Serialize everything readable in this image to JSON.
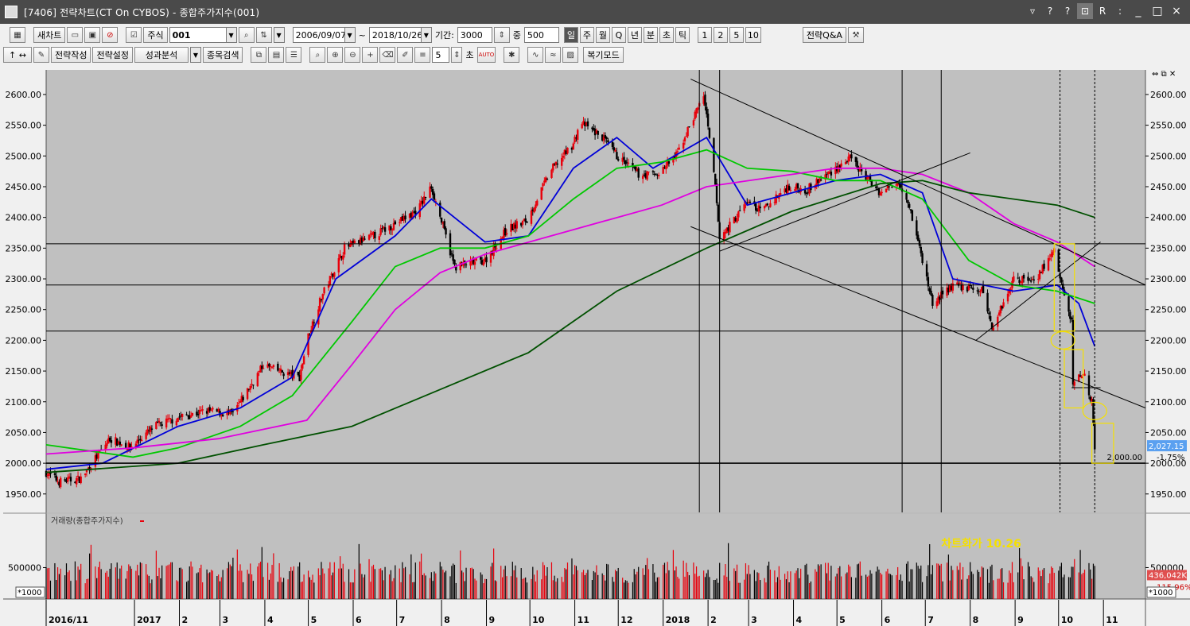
{
  "window": {
    "title": "[7406] 전략차트(CT On CYBOS) - 종합주가지수(001)",
    "buttons": [
      "?",
      "?",
      "R",
      "_",
      "□",
      "×"
    ]
  },
  "toolbar1": {
    "new_chart": "새차트",
    "stock_type": "주식",
    "code": "001",
    "start_date": "2006/09/07",
    "tilde": "~",
    "end_date": "2018/10/26",
    "period_label": "기간:",
    "period_value": "3000",
    "count_label": "중",
    "count_value": "500",
    "periods": [
      "일",
      "주",
      "월",
      "Q",
      "년",
      "분",
      "초",
      "틱"
    ],
    "selected_period": "일",
    "numbers": [
      "1",
      "2",
      "5",
      "10"
    ],
    "qa": "전략Q&A"
  },
  "toolbar2": {
    "arrows": "↑ ↔",
    "strategy_write": "전략작성",
    "strategy_set": "전략설정",
    "perf_analysis": "성과분석",
    "stock_search": "종목검색",
    "sec_value": "5",
    "sec_label": "초",
    "auto_label": "AUTO",
    "review_mode": "복기모드"
  },
  "colors": {
    "bg_chart": "#c0c0c0",
    "up": "#e8000b",
    "down": "#000000",
    "ma_blue": "#0000d8",
    "ma_green": "#00c800",
    "ma_magenta": "#e000e0",
    "ma_darkgreen": "#005000",
    "annotation": "#f5e000"
  },
  "chart_data": {
    "type": "candlestick",
    "title": "",
    "price_axis": {
      "ylim": [
        1920,
        2640
      ],
      "ticks": [
        "2600.00",
        "2550.00",
        "2500.00",
        "2450.00",
        "2400.00",
        "2350.00",
        "2300.00",
        "2250.00",
        "2200.00",
        "2150.00",
        "2100.00",
        "2050.00",
        "2000.00",
        "1950.00"
      ]
    },
    "x_labels": [
      "2016/11",
      "2017",
      "2",
      "3",
      "4",
      "5",
      "6",
      "7",
      "8",
      "9",
      "10",
      "11",
      "12",
      "2018",
      "2",
      "3",
      "4",
      "5",
      "6",
      "7",
      "8",
      "9",
      "10",
      "11"
    ],
    "x_start": "2016-11-01",
    "x_end": "2018-11-30",
    "last_date": "2018-10-26",
    "current_price": "2,027.15",
    "change_pct": "-1.75%",
    "level_label": "2,000.00",
    "level_value": 2000,
    "horizontal_lines": [
      2357,
      2290,
      2215,
      2000
    ],
    "price_keypoints": [
      [
        "2016-11-01",
        1985
      ],
      [
        "2016-11-10",
        1970
      ],
      [
        "2016-11-25",
        1975
      ],
      [
        "2016-12-15",
        2040
      ],
      [
        "2016-12-29",
        2026
      ],
      [
        "2017-01-15",
        2060
      ],
      [
        "2017-02-01",
        2075
      ],
      [
        "2017-02-20",
        2085
      ],
      [
        "2017-03-10",
        2080
      ],
      [
        "2017-03-31",
        2160
      ],
      [
        "2017-04-10",
        2150
      ],
      [
        "2017-04-25",
        2140
      ],
      [
        "2017-04-30",
        2200
      ],
      [
        "2017-05-10",
        2270
      ],
      [
        "2017-05-26",
        2350
      ],
      [
        "2017-06-15",
        2370
      ],
      [
        "2017-06-30",
        2390
      ],
      [
        "2017-07-15",
        2410
      ],
      [
        "2017-07-25",
        2450
      ],
      [
        "2017-08-10",
        2320
      ],
      [
        "2017-08-31",
        2330
      ],
      [
        "2017-09-15",
        2380
      ],
      [
        "2017-09-29",
        2395
      ],
      [
        "2017-10-15",
        2475
      ],
      [
        "2017-10-31",
        2520
      ],
      [
        "2017-11-05",
        2555
      ],
      [
        "2017-11-20",
        2530
      ],
      [
        "2017-11-30",
        2500
      ],
      [
        "2017-12-15",
        2470
      ],
      [
        "2017-12-28",
        2470
      ],
      [
        "2018-01-10",
        2500
      ],
      [
        "2018-01-29",
        2600
      ],
      [
        "2018-02-06",
        2450
      ],
      [
        "2018-02-09",
        2365
      ],
      [
        "2018-02-28",
        2425
      ],
      [
        "2018-03-10",
        2410
      ],
      [
        "2018-03-28",
        2450
      ],
      [
        "2018-04-10",
        2445
      ],
      [
        "2018-04-30",
        2480
      ],
      [
        "2018-05-10",
        2495
      ],
      [
        "2018-05-31",
        2440
      ],
      [
        "2018-06-13",
        2460
      ],
      [
        "2018-06-20",
        2420
      ],
      [
        "2018-06-29",
        2330
      ],
      [
        "2018-07-06",
        2260
      ],
      [
        "2018-07-20",
        2290
      ],
      [
        "2018-08-10",
        2280
      ],
      [
        "2018-08-16",
        2220
      ],
      [
        "2018-08-31",
        2300
      ],
      [
        "2018-09-15",
        2300
      ],
      [
        "2018-09-28",
        2345
      ],
      [
        "2018-10-05",
        2270
      ],
      [
        "2018-10-10",
        2230
      ],
      [
        "2018-10-11",
        2130
      ],
      [
        "2018-10-18",
        2150
      ],
      [
        "2018-10-24",
        2100
      ],
      [
        "2018-10-26",
        2027
      ]
    ],
    "moving_averages": [
      {
        "color": "blue",
        "points": [
          [
            "2016-11-01",
            1990
          ],
          [
            "2016-12-10",
            2000
          ],
          [
            "2017-01-31",
            2060
          ],
          [
            "2017-03-15",
            2090
          ],
          [
            "2017-04-20",
            2140
          ],
          [
            "2017-05-20",
            2300
          ],
          [
            "2017-06-30",
            2370
          ],
          [
            "2017-07-25",
            2430
          ],
          [
            "2017-08-31",
            2360
          ],
          [
            "2017-09-30",
            2370
          ],
          [
            "2017-10-31",
            2480
          ],
          [
            "2017-11-30",
            2530
          ],
          [
            "2017-12-25",
            2480
          ],
          [
            "2018-01-31",
            2530
          ],
          [
            "2018-02-28",
            2420
          ],
          [
            "2018-03-31",
            2440
          ],
          [
            "2018-04-30",
            2460
          ],
          [
            "2018-05-31",
            2470
          ],
          [
            "2018-06-29",
            2440
          ],
          [
            "2018-07-20",
            2300
          ],
          [
            "2018-08-31",
            2280
          ],
          [
            "2018-09-30",
            2290
          ],
          [
            "2018-10-15",
            2260
          ],
          [
            "2018-10-26",
            2190
          ]
        ]
      },
      {
        "color": "green",
        "points": [
          [
            "2016-11-01",
            2030
          ],
          [
            "2016-12-31",
            2010
          ],
          [
            "2017-01-31",
            2025
          ],
          [
            "2017-03-15",
            2060
          ],
          [
            "2017-04-20",
            2110
          ],
          [
            "2017-05-31",
            2230
          ],
          [
            "2017-06-30",
            2320
          ],
          [
            "2017-07-31",
            2350
          ],
          [
            "2017-08-31",
            2350
          ],
          [
            "2017-09-30",
            2370
          ],
          [
            "2017-10-31",
            2430
          ],
          [
            "2017-11-30",
            2480
          ],
          [
            "2017-12-31",
            2490
          ],
          [
            "2018-01-31",
            2510
          ],
          [
            "2018-02-28",
            2480
          ],
          [
            "2018-03-31",
            2475
          ],
          [
            "2018-04-30",
            2460
          ],
          [
            "2018-05-31",
            2460
          ],
          [
            "2018-06-29",
            2430
          ],
          [
            "2018-07-31",
            2330
          ],
          [
            "2018-08-31",
            2290
          ],
          [
            "2018-09-30",
            2280
          ],
          [
            "2018-10-26",
            2260
          ]
        ]
      },
      {
        "color": "magenta",
        "points": [
          [
            "2016-11-01",
            2015
          ],
          [
            "2016-12-31",
            2025
          ],
          [
            "2017-02-28",
            2040
          ],
          [
            "2017-04-30",
            2070
          ],
          [
            "2017-05-31",
            2160
          ],
          [
            "2017-06-30",
            2250
          ],
          [
            "2017-07-31",
            2310
          ],
          [
            "2017-08-31",
            2340
          ],
          [
            "2017-10-31",
            2380
          ],
          [
            "2017-12-31",
            2420
          ],
          [
            "2018-01-31",
            2450
          ],
          [
            "2018-03-31",
            2470
          ],
          [
            "2018-04-30",
            2480
          ],
          [
            "2018-05-31",
            2480
          ],
          [
            "2018-06-29",
            2470
          ],
          [
            "2018-07-31",
            2440
          ],
          [
            "2018-08-31",
            2390
          ],
          [
            "2018-09-30",
            2360
          ],
          [
            "2018-10-26",
            2320
          ]
        ]
      },
      {
        "color": "darkgreen",
        "points": [
          [
            "2016-11-01",
            1985
          ],
          [
            "2017-01-31",
            2000
          ],
          [
            "2017-03-31",
            2030
          ],
          [
            "2017-05-31",
            2060
          ],
          [
            "2017-07-31",
            2120
          ],
          [
            "2017-09-30",
            2180
          ],
          [
            "2017-11-30",
            2280
          ],
          [
            "2018-01-31",
            2350
          ],
          [
            "2018-03-31",
            2410
          ],
          [
            "2018-05-31",
            2455
          ],
          [
            "2018-06-29",
            2460
          ],
          [
            "2018-07-31",
            2440
          ],
          [
            "2018-09-30",
            2420
          ],
          [
            "2018-10-26",
            2400
          ]
        ]
      }
    ],
    "volume": {
      "label": "거래량(종합주가지수)",
      "ylim": [
        0,
        1100000
      ],
      "tick": "500000",
      "unit": "*1000",
      "current": "436,042K",
      "pct": "115.96%"
    },
    "annotation": "차트화가 10.26"
  }
}
